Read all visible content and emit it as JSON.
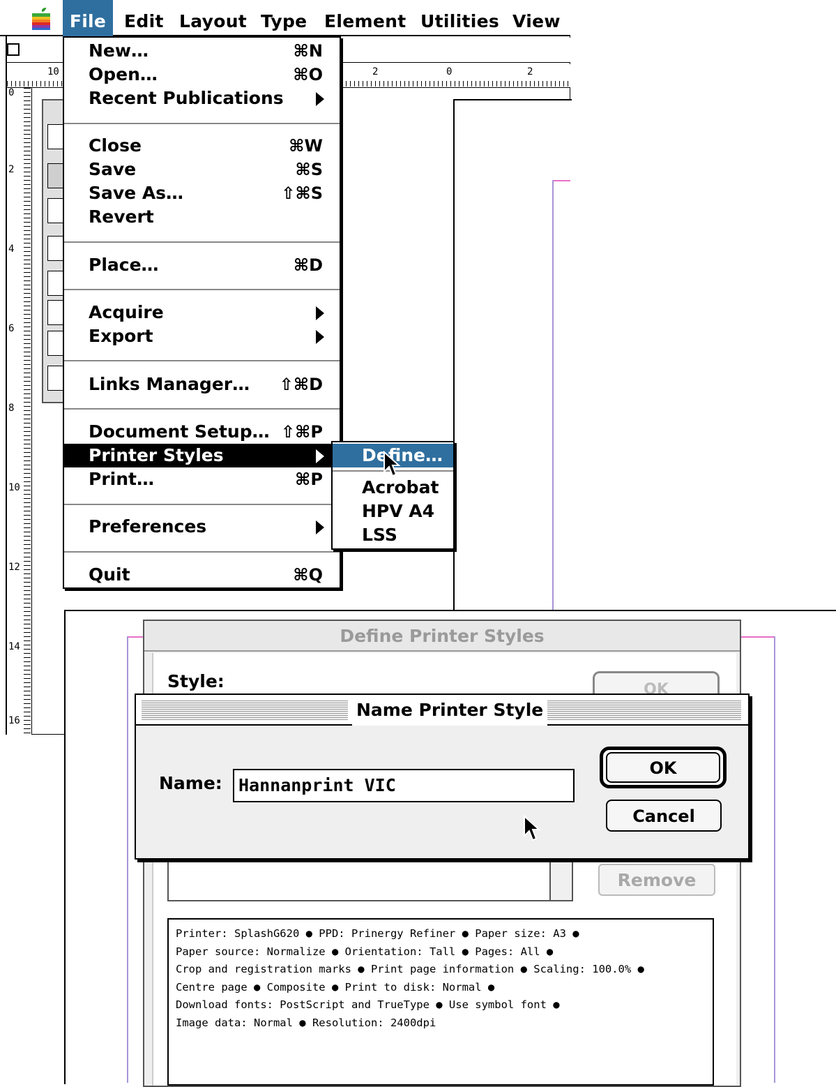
{
  "menubar": {
    "items": [
      "File",
      "Edit",
      "Layout",
      "Type",
      "Element",
      "Utilities",
      "View"
    ],
    "active": "File"
  },
  "rulers": {
    "horizontal": [
      "10",
      "2",
      "0",
      "2"
    ],
    "vertical": [
      "0",
      "2",
      "4",
      "6",
      "8",
      "10",
      "12",
      "14",
      "16"
    ]
  },
  "file_menu": {
    "items": [
      {
        "label": "New…",
        "shortcut": "⌘N"
      },
      {
        "label": "Open…",
        "shortcut": "⌘O"
      },
      {
        "label": "Recent Publications",
        "submenu": true
      },
      {
        "label": "Close",
        "shortcut": "⌘W"
      },
      {
        "label": "Save",
        "shortcut": "⌘S"
      },
      {
        "label": "Save As…",
        "shortcut": "⇧⌘S"
      },
      {
        "label": "Revert"
      },
      {
        "label": "Place…",
        "shortcut": "⌘D"
      },
      {
        "label": "Acquire",
        "submenu": true
      },
      {
        "label": "Export",
        "submenu": true
      },
      {
        "label": "Links Manager…",
        "shortcut": "⇧⌘D"
      },
      {
        "label": "Document Setup…",
        "shortcut": "⇧⌘P"
      },
      {
        "label": "Printer Styles",
        "submenu": true
      },
      {
        "label": "Print…",
        "shortcut": "⌘P"
      },
      {
        "label": "Preferences",
        "submenu": true
      },
      {
        "label": "Quit",
        "shortcut": "⌘Q"
      }
    ]
  },
  "printer_styles_submenu": {
    "items": [
      "Define…",
      "Acrobat",
      "HPV A4",
      "LSS"
    ],
    "highlighted": "Define…"
  },
  "define_dialog": {
    "title": "Define Printer Styles",
    "style_label": "Style:",
    "ok_label": "OK",
    "remove_label": "Remove",
    "info_lines": [
      "Printer: SplashG620 ● PPD: Prinergy Refiner ● Paper size: A3 ●",
      "Paper source: Normalize ● Orientation: Tall ● Pages: All ●",
      "Crop and registration marks ● Print page information ● Scaling: 100.0% ●",
      "Centre page ● Composite ● Print to disk: Normal ●",
      "Download fonts: PostScript and TrueType ● Use symbol font ●",
      "Image data: Normal ● Resolution: 2400dpi"
    ]
  },
  "name_dialog": {
    "title": "Name Printer Style",
    "name_label": "Name:",
    "name_value": "Hannanprint VIC",
    "ok_label": "OK",
    "cancel_label": "Cancel"
  },
  "colors": {
    "highlight_blue": "#2f6f9f",
    "margin_guide": "#a894d8",
    "pasteboard_guide": "#e870c8"
  }
}
